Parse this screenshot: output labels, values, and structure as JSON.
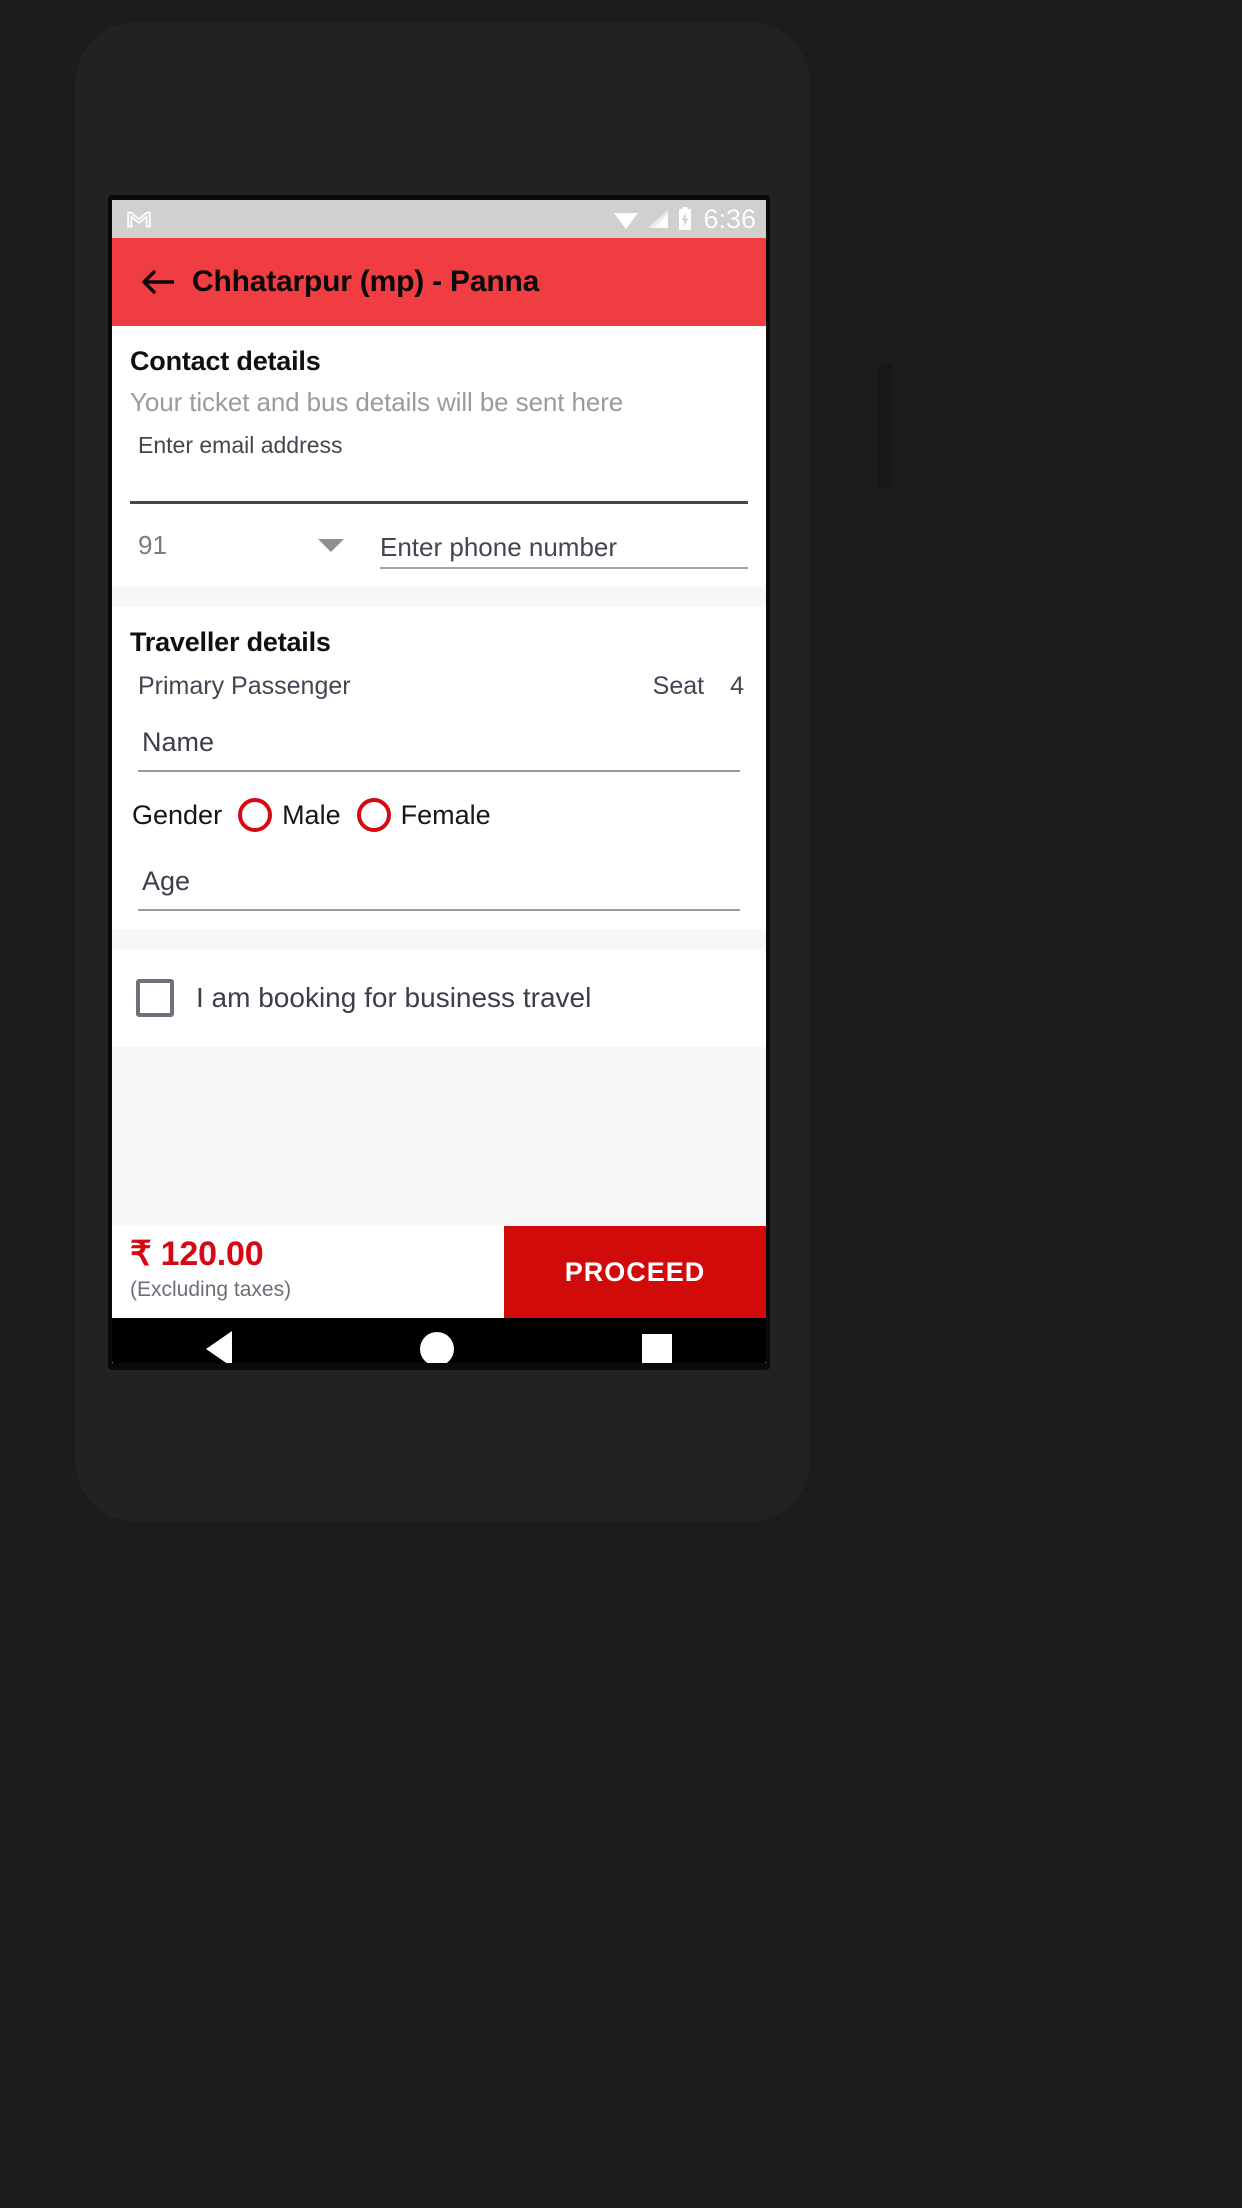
{
  "status_bar": {
    "app_icon": "gmail-icon",
    "wifi_icon": "wifi-icon",
    "signal_icon": "signal-bars-icon",
    "battery_icon": "battery-charging-icon",
    "time": "6:36"
  },
  "app_bar": {
    "back_icon": "back-arrow-icon",
    "title": "Chhatarpur (mp) - Panna",
    "background_color": "#ef3d42",
    "title_color": "#0a0a0a"
  },
  "contact_details": {
    "title": "Contact details",
    "subtitle": "Your ticket and bus details will be sent here",
    "email": {
      "label": "Enter email address",
      "value": ""
    },
    "country_code": {
      "value": "91",
      "caret_icon": "chevron-down-icon"
    },
    "phone": {
      "placeholder": "Enter phone number",
      "value": ""
    }
  },
  "traveller_details": {
    "title": "Traveller details",
    "passenger_label": "Primary Passenger",
    "seat_label": "Seat",
    "seat_number": "4",
    "name": {
      "placeholder": "Name",
      "value": ""
    },
    "gender": {
      "label": "Gender",
      "options": [
        {
          "label": "Male",
          "selected": false
        },
        {
          "label": "Female",
          "selected": false
        }
      ],
      "radio_color": "#d60812"
    },
    "age": {
      "placeholder": "Age",
      "value": ""
    }
  },
  "business_travel": {
    "label": "I am booking for business travel",
    "checked": false
  },
  "bottom_bar": {
    "price": "₹ 120.00",
    "price_note": "(Excluding taxes)",
    "price_color": "#d60812",
    "proceed_label": "PROCEED",
    "proceed_color": "#d10a0a"
  },
  "nav_bar": {
    "back_icon": "nav-back-triangle-icon",
    "home_icon": "nav-home-circle-icon",
    "recents_icon": "nav-recents-square-icon"
  }
}
